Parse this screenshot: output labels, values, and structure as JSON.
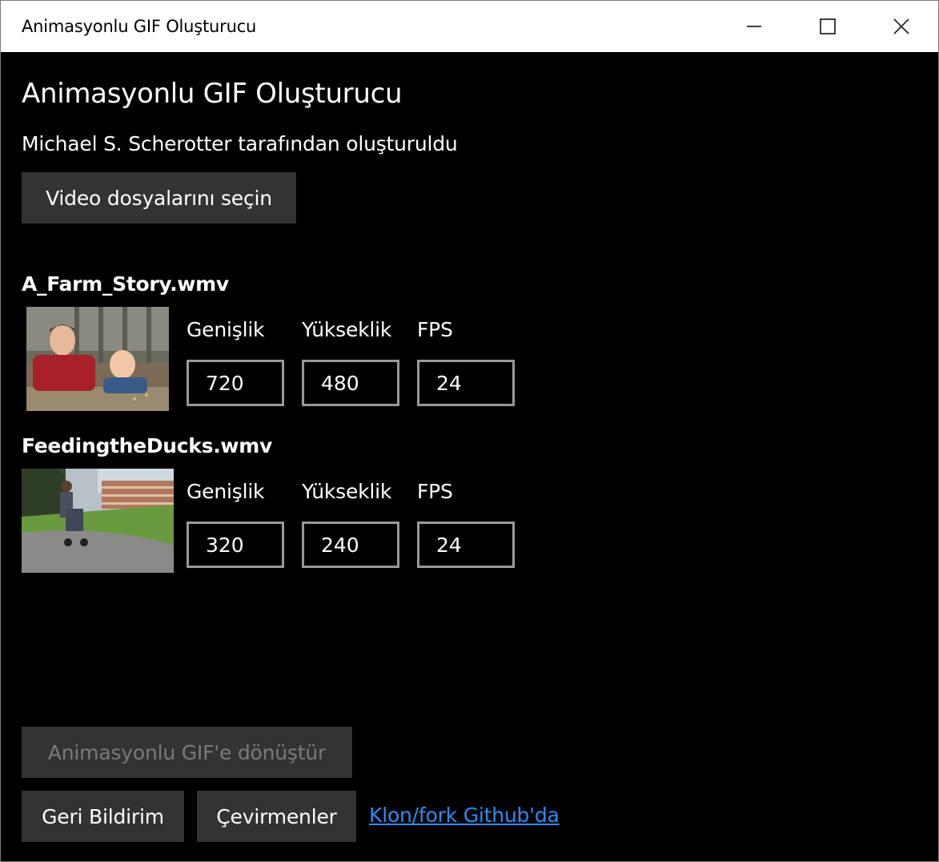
{
  "window": {
    "title": "Animasyonlu GIF Oluşturucu",
    "controls": {
      "minimize": "minimize-icon",
      "maximize": "maximize-icon",
      "close": "close-icon"
    }
  },
  "header": {
    "title": "Animasyonlu GIF Oluşturucu",
    "author": "Michael S. Scherotter tarafından oluşturuldu"
  },
  "select_button": "Video dosyalarını seçin",
  "videos": [
    {
      "filename": "A_Farm_Story.wmv",
      "width_label": "Genişlik",
      "height_label": "Yükseklik",
      "fps_label": "FPS",
      "width": "720",
      "height": "480",
      "fps": "24"
    },
    {
      "filename": "FeedingtheDucks.wmv",
      "width_label": "Genişlik",
      "height_label": "Yükseklik",
      "fps_label": "FPS",
      "width": "320",
      "height": "240",
      "fps": "24"
    }
  ],
  "footer": {
    "convert_button": "Animasyonlu GIF'e dönüştür",
    "feedback_button": "Geri Bildirim",
    "translators_button": "Çevirmenler",
    "github_link": "Klon/fork Github'da"
  },
  "colors": {
    "background": "#000000",
    "button": "#333333",
    "link": "#2b8df0",
    "field_border": "#999999",
    "disabled_text": "#7a7a7a"
  }
}
